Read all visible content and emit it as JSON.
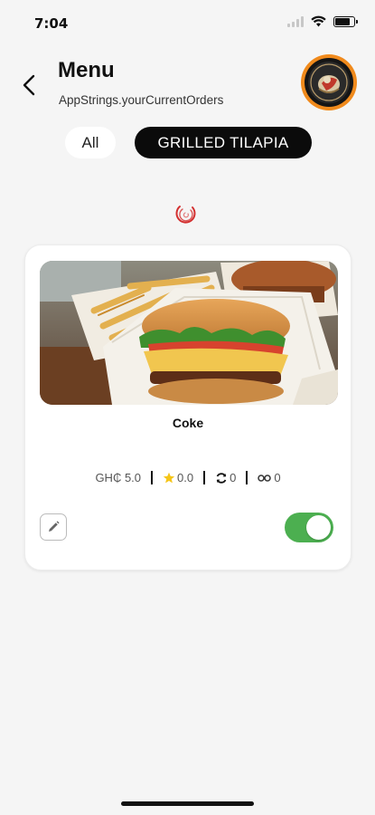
{
  "status_bar": {
    "time": "7:04"
  },
  "header": {
    "title": "Menu",
    "subtitle": "AppStrings.yourCurrentOrders"
  },
  "filters": [
    {
      "label": "All",
      "selected": false
    },
    {
      "label": "GRILLED TILAPIA",
      "selected": true
    }
  ],
  "item": {
    "name": "Coke",
    "price": "GH₵ 5.0",
    "rating": "0.0",
    "reorders": "0",
    "views": "0",
    "available": true
  },
  "colors": {
    "accent_orange": "#f08a1c",
    "toggle_green": "#4caf50",
    "spinner_red": "#d32f2f",
    "star_yellow": "#f5c518"
  },
  "icons": [
    "back-arrow-icon",
    "profile-avatar",
    "loading-spinner-icon",
    "star-icon",
    "refresh-icon",
    "views-icon",
    "pencil-icon"
  ]
}
